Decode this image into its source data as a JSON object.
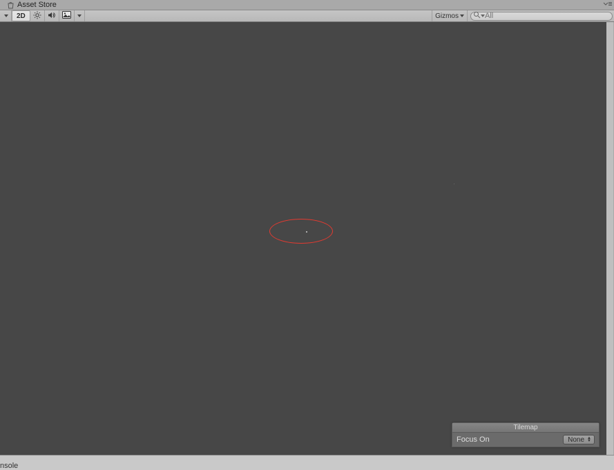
{
  "tabs": {
    "asset_store": "Asset Store"
  },
  "toolbar": {
    "mode_2d": "2D",
    "gizmos_label": "Gizmos"
  },
  "search": {
    "placeholder": "All"
  },
  "tilemap": {
    "title": "Tilemap",
    "focus_label": "Focus On",
    "focus_value": "None"
  },
  "bottom": {
    "console": "nsole"
  }
}
